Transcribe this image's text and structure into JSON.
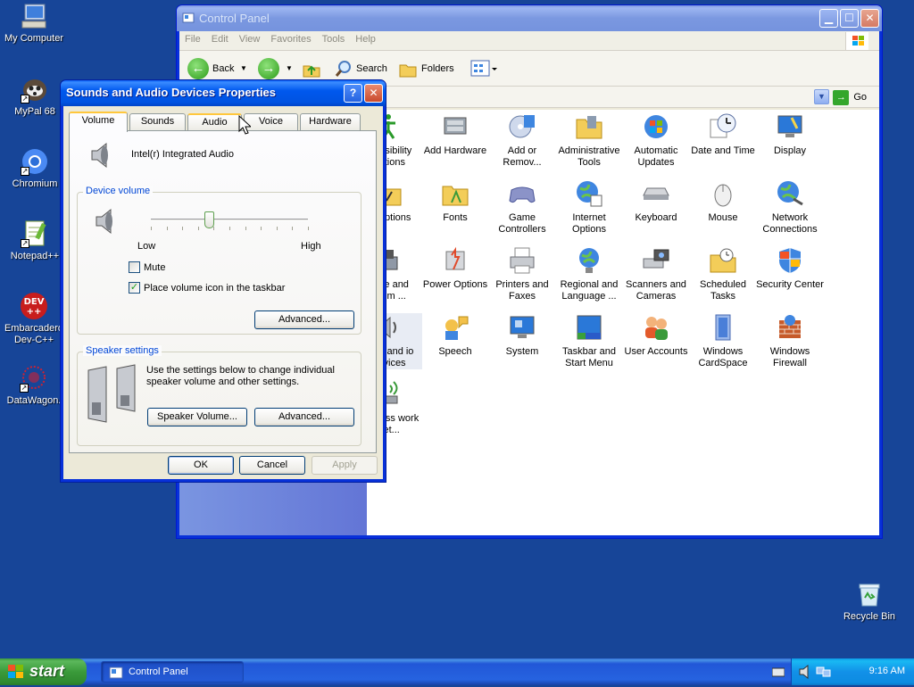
{
  "desktop": {
    "icons": [
      {
        "label": "My Computer"
      },
      {
        "label": "MyPal 68"
      },
      {
        "label": "Chromium"
      },
      {
        "label": "Notepad++"
      },
      {
        "label": "Embarcadero Dev-C++"
      },
      {
        "label": "DataWagon."
      },
      {
        "label": "Recycle Bin"
      }
    ]
  },
  "control_panel": {
    "title": "Control Panel",
    "menu": [
      "File",
      "Edit",
      "View",
      "Favorites",
      "Tools",
      "Help"
    ],
    "toolbar": {
      "back": "Back",
      "search": "Search",
      "folders": "Folders"
    },
    "go_label": "Go",
    "items": [
      {
        "label": "ccessibility Options"
      },
      {
        "label": "Add Hardware"
      },
      {
        "label": "Add or Remov..."
      },
      {
        "label": "Administrative Tools"
      },
      {
        "label": "Automatic Updates"
      },
      {
        "label": "Date and Time"
      },
      {
        "label": "Display"
      },
      {
        "label": "er Options"
      },
      {
        "label": "Fonts"
      },
      {
        "label": "Game Controllers"
      },
      {
        "label": "Internet Options"
      },
      {
        "label": "Keyboard"
      },
      {
        "label": "Mouse"
      },
      {
        "label": "Network Connections"
      },
      {
        "label": "hone and odem ..."
      },
      {
        "label": "Power Options"
      },
      {
        "label": "Printers and Faxes"
      },
      {
        "label": "Regional and Language ..."
      },
      {
        "label": "Scanners and Cameras"
      },
      {
        "label": "Scheduled Tasks"
      },
      {
        "label": "Security Center"
      },
      {
        "label": "unds and io Devices"
      },
      {
        "label": "Speech"
      },
      {
        "label": "System"
      },
      {
        "label": "Taskbar and Start Menu"
      },
      {
        "label": "User Accounts"
      },
      {
        "label": "Windows CardSpace"
      },
      {
        "label": "Windows Firewall"
      },
      {
        "label": "Wireless work Set..."
      }
    ]
  },
  "dialog": {
    "title": "Sounds and Audio Devices Properties",
    "tabs": [
      "Volume",
      "Sounds",
      "Audio",
      "Voice",
      "Hardware"
    ],
    "active_tab": "Volume",
    "device_name": "Intel(r) Integrated Audio",
    "device_volume": {
      "title": "Device volume",
      "low": "Low",
      "high": "High",
      "level": 0.37
    },
    "mute_label": "Mute",
    "mute_checked": false,
    "taskbar_icon_label": "Place volume icon in the taskbar",
    "taskbar_icon_checked": true,
    "advanced_label": "Advanced...",
    "speaker": {
      "title": "Speaker settings",
      "description": "Use the settings below to change individual speaker volume and other settings.",
      "volume_button": "Speaker Volume...",
      "advanced_button": "Advanced..."
    },
    "buttons": {
      "ok": "OK",
      "cancel": "Cancel",
      "apply": "Apply"
    }
  },
  "taskbar": {
    "start": "start",
    "task": "Control Panel",
    "clock": "9:16 AM"
  }
}
